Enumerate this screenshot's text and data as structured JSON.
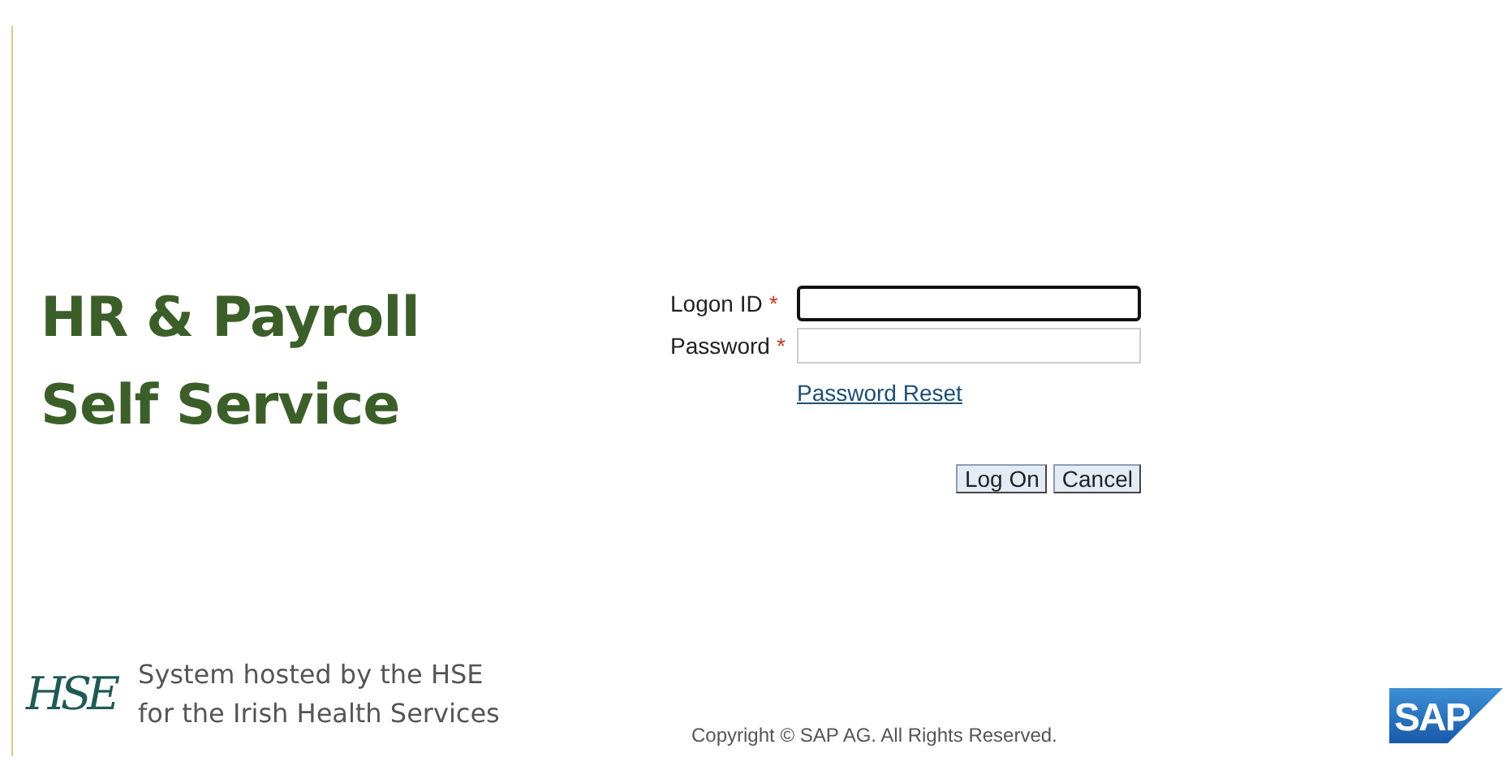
{
  "title": [
    "HR & Payroll",
    "Self Service"
  ],
  "form": {
    "fields": [
      {
        "label": "Logon ID",
        "required_mark": "*",
        "focused": true
      },
      {
        "label": "Password",
        "required_mark": "*",
        "focused": false
      }
    ],
    "link": "Password Reset",
    "buttons": [
      "Log On",
      "Cancel"
    ]
  },
  "footer": {
    "host_logo": "HSE",
    "host_lines": [
      "System hosted by the HSE",
      "for the Irish Health Services"
    ],
    "copyright": "Copyright © SAP AG. All Rights Reserved.",
    "vendor_logo": "SAP"
  }
}
